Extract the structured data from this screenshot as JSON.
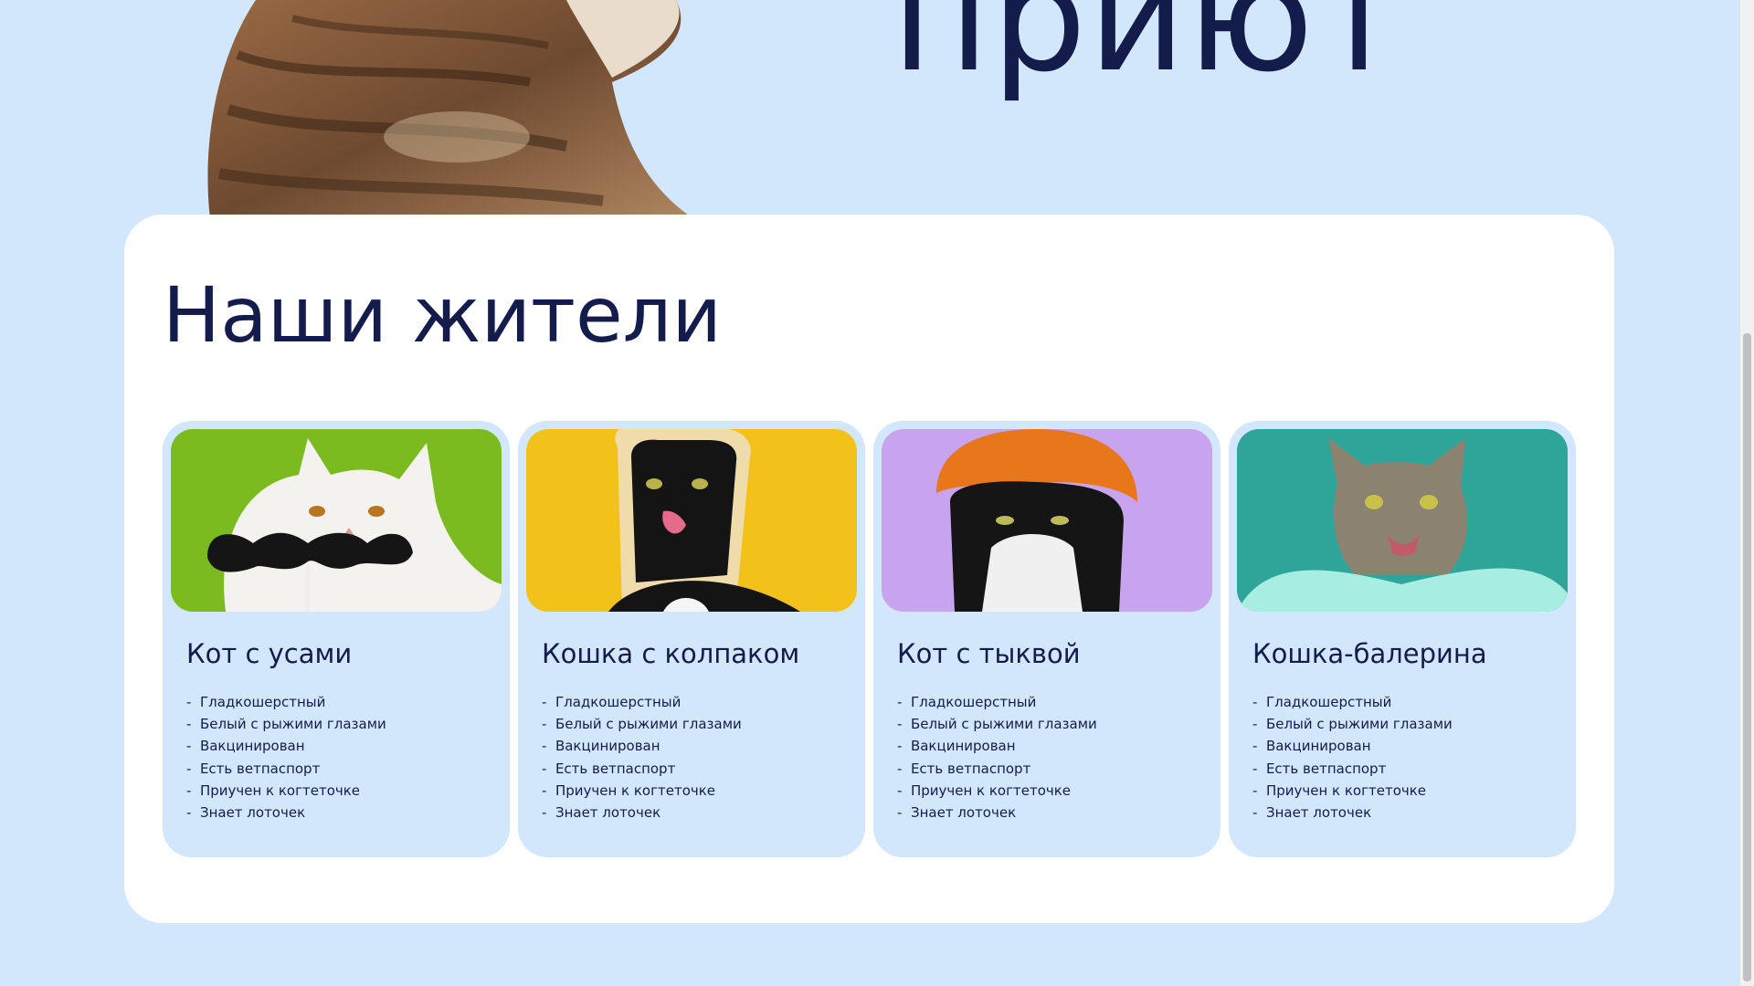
{
  "hero": {
    "title": "приют",
    "image": "tabby-cat-photo"
  },
  "residents": {
    "title": "Наши жители",
    "cards": [
      {
        "name": "Кот с усами",
        "image": "white-cat-mustache-photo",
        "traits": [
          "Гладкошерстный",
          "Белый с рыжими глазами",
          "Вакцинирован",
          "Есть ветпаспорт",
          "Приучен к когтеточке",
          "Знает лоточек"
        ]
      },
      {
        "name": "Кошка с колпаком",
        "image": "black-cat-bread-photo",
        "traits": [
          "Гладкошерстный",
          "Белый с рыжими глазами",
          "Вакцинирован",
          "Есть ветпаспорт",
          "Приучен к когтеточке",
          "Знает лоточек"
        ]
      },
      {
        "name": "Кот с тыквой",
        "image": "tuxedo-cat-pumpkin-photo",
        "traits": [
          "Гладкошерстный",
          "Белый с рыжими глазами",
          "Вакцинирован",
          "Есть ветпаспорт",
          "Приучен к когтеточке",
          "Знает лоточек"
        ]
      },
      {
        "name": "Кошка-балерина",
        "image": "tabby-cat-tutu-photo",
        "traits": [
          "Гладкошерстный",
          "Белый с рыжими глазами",
          "Вакцинирован",
          "Есть ветпаспорт",
          "Приучен к когтеточке",
          "Знает лоточек"
        ]
      }
    ]
  },
  "colors": {
    "page_bg": "#d2e7fc",
    "heading": "#141c4b",
    "panel_bg": "#ffffff"
  }
}
